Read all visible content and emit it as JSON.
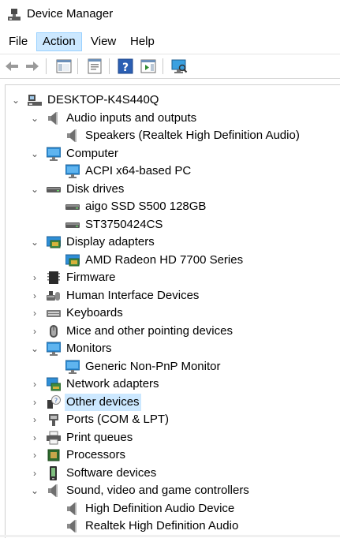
{
  "window": {
    "title": "Device Manager"
  },
  "menu": {
    "file": "File",
    "action": "Action",
    "view": "View",
    "help": "Help"
  },
  "toolbar": {
    "buttons": [
      "back-arrow",
      "forward-arrow",
      "show-hide-console-tree",
      "properties",
      "help",
      "action-pane",
      "scan-hardware-monitor"
    ]
  },
  "tree": {
    "root": "DESKTOP-K4S440Q",
    "items": [
      {
        "label": "Audio inputs and outputs",
        "expanded": true,
        "icon": "speaker-icon",
        "children": [
          "Speakers (Realtek High Definition Audio)"
        ]
      },
      {
        "label": "Computer",
        "expanded": true,
        "icon": "monitor-icon",
        "children": [
          "ACPI x64-based PC"
        ]
      },
      {
        "label": "Disk drives",
        "expanded": true,
        "icon": "disk-drive-icon",
        "children": [
          "aigo SSD S500 128GB",
          "ST3750424CS"
        ]
      },
      {
        "label": "Display adapters",
        "expanded": true,
        "icon": "display-adapter-icon",
        "children": [
          "AMD Radeon HD 7700 Series"
        ]
      },
      {
        "label": "Firmware",
        "expanded": false,
        "icon": "firmware-icon",
        "children": []
      },
      {
        "label": "Human Interface Devices",
        "expanded": false,
        "icon": "hid-icon",
        "children": []
      },
      {
        "label": "Keyboards",
        "expanded": false,
        "icon": "keyboard-icon",
        "children": []
      },
      {
        "label": "Mice and other pointing devices",
        "expanded": false,
        "icon": "mouse-icon",
        "children": []
      },
      {
        "label": "Monitors",
        "expanded": true,
        "icon": "monitor-icon",
        "children": [
          "Generic Non-PnP Monitor"
        ]
      },
      {
        "label": "Network adapters",
        "expanded": false,
        "icon": "network-adapter-icon",
        "children": []
      },
      {
        "label": "Other devices",
        "expanded": false,
        "icon": "unknown-device-icon",
        "selected": true,
        "children": []
      },
      {
        "label": "Ports (COM & LPT)",
        "expanded": false,
        "icon": "port-icon",
        "children": []
      },
      {
        "label": "Print queues",
        "expanded": false,
        "icon": "printer-icon",
        "children": []
      },
      {
        "label": "Processors",
        "expanded": false,
        "icon": "processor-icon",
        "children": []
      },
      {
        "label": "Software devices",
        "expanded": false,
        "icon": "software-device-icon",
        "children": []
      },
      {
        "label": "Sound, video and game controllers",
        "expanded": true,
        "icon": "speaker-icon",
        "children": [
          "High Definition Audio Device",
          "Realtek High Definition Audio"
        ]
      }
    ]
  }
}
